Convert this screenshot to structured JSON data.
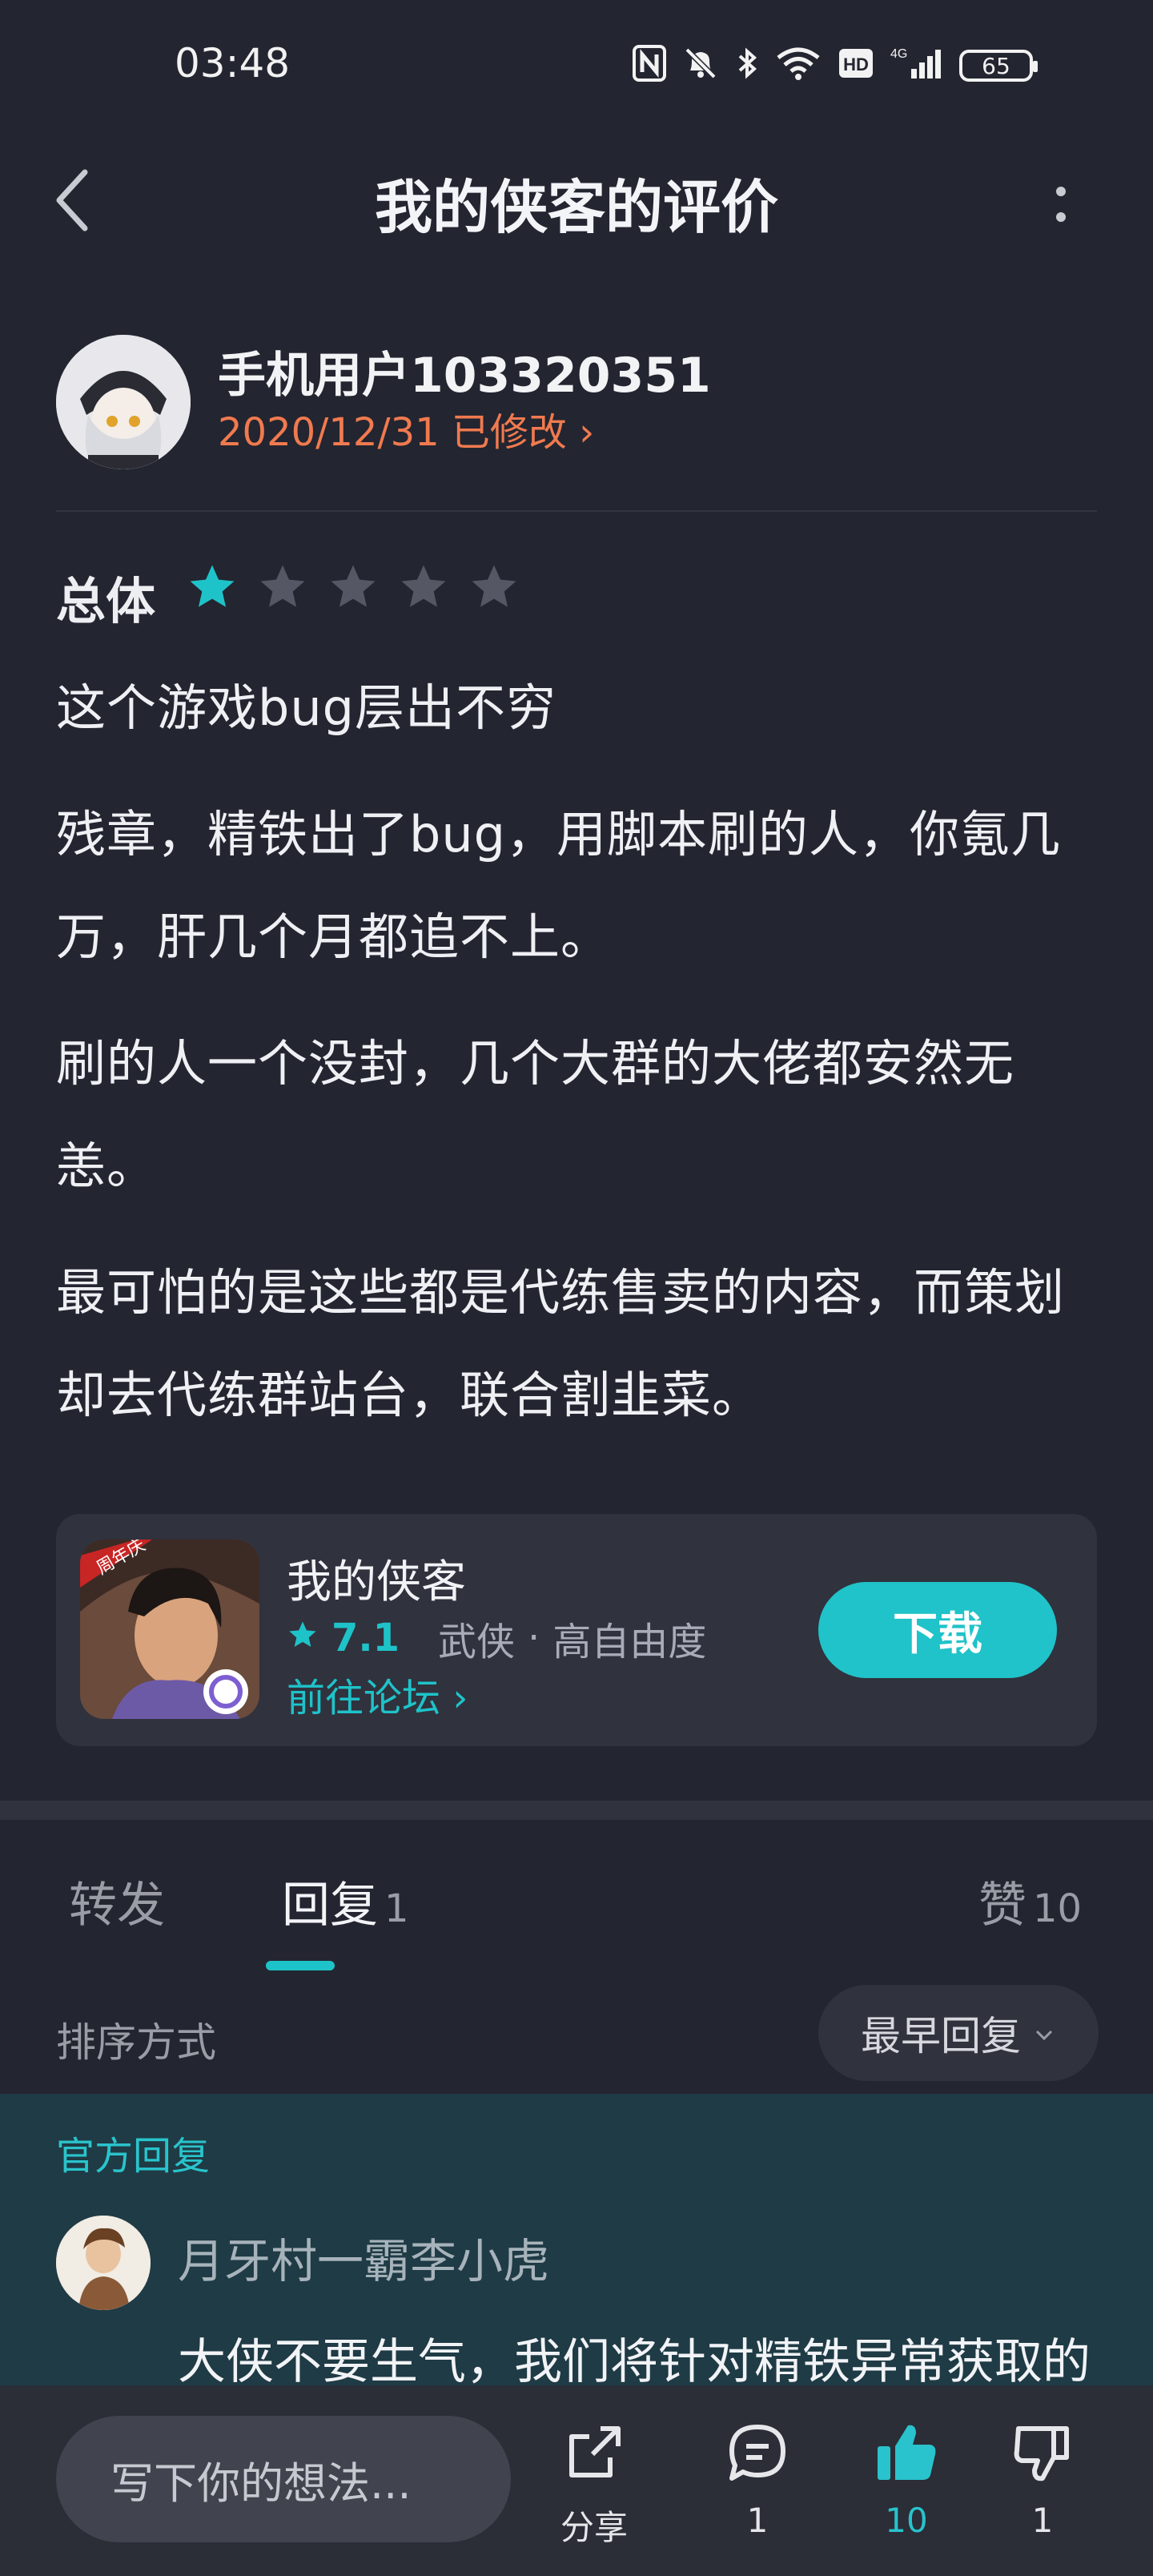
{
  "status_bar": {
    "time": "03:48",
    "battery": "65",
    "network": "4G"
  },
  "nav": {
    "title": "我的侠客的评价"
  },
  "author": {
    "name": "手机用户103320351",
    "date": "2020/12/31 已修改 ›"
  },
  "rating": {
    "label": "总体",
    "stars": 1,
    "max": 5
  },
  "review": {
    "paragraphs": [
      "这个游戏bug层出不穷",
      "残章，精铁出了bug，用脚本刷的人，你氪几万，肝几个月都追不上。",
      "刷的人一个没封，几个大群的大佬都安然无恙。",
      "最可怕的是这些都是代练售卖的内容，而策划却去代练群站台，联合割韭菜。"
    ]
  },
  "game_card": {
    "name": "我的侠客",
    "score": "7.1",
    "tags": [
      "武侠",
      "高自由度"
    ],
    "separator": "·",
    "forum_link": "前往论坛 ›",
    "download_label": "下载",
    "badge": "周年庆"
  },
  "tabs": {
    "forward": "转发",
    "reply": "回复",
    "reply_count": "1",
    "like": "赞",
    "like_count": "10"
  },
  "sort": {
    "label": "排序方式",
    "selected": "最早回复"
  },
  "official_reply": {
    "label": "官方回复",
    "author": "月牙村一霸李小虎",
    "text": "大侠不要生气，我们将针对精铁异常获取的"
  },
  "bottom_bar": {
    "input_placeholder": "写下你的想法...",
    "share_label": "分享",
    "comment_count": "1",
    "like_count": "10",
    "dislike_count": "1"
  },
  "colors": {
    "background": "#232530",
    "accent": "#1ec3c9",
    "date_orange": "#f07a4f",
    "official_bg": "#1f3b45"
  }
}
